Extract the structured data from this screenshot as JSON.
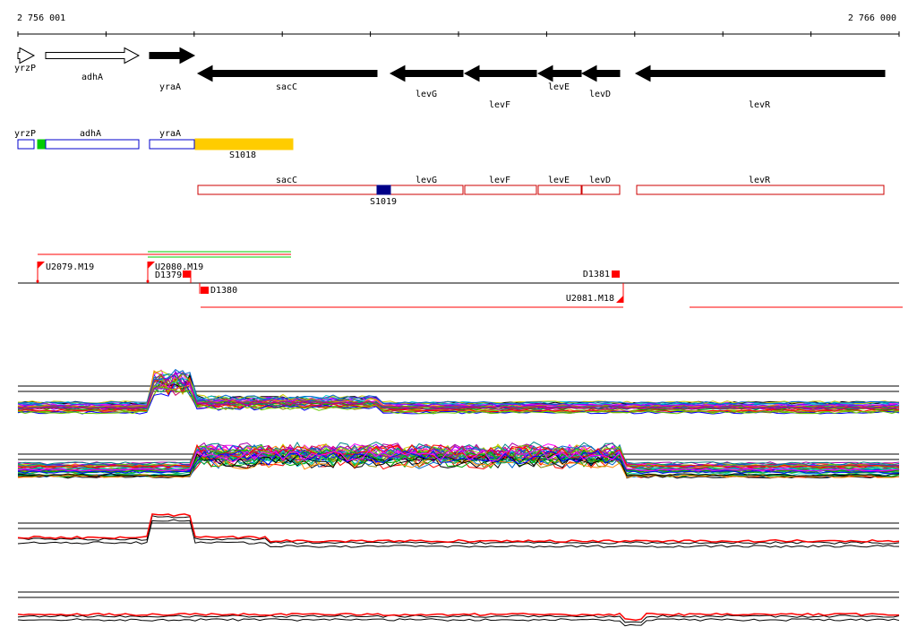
{
  "coordinates": {
    "start": "2 756 001",
    "end": "2 766 000"
  },
  "colors": {
    "gene_fill": "#000000",
    "gene_outline": "#000000",
    "blue_box": "#0000cc",
    "red_box": "#cc0000",
    "orange_box": "#ffcc00",
    "green_box": "#00cc00",
    "navy_box": "#000088",
    "marker_red": "#ff0000",
    "track_line": "#000000"
  },
  "genes_forward": [
    {
      "label": "yrzP",
      "start": 20,
      "end": 38,
      "filled": false
    },
    {
      "label": "adhA",
      "start": 51,
      "end": 155,
      "filled": false
    },
    {
      "label": "yraA",
      "start": 167,
      "end": 217,
      "filled": true
    }
  ],
  "genes_reverse": [
    {
      "label": "sacC",
      "start": 221,
      "end": 421
    },
    {
      "label": "levG",
      "start": 436,
      "end": 517
    },
    {
      "label": "levF",
      "start": 519,
      "end": 599
    },
    {
      "label": "levE",
      "start": 601,
      "end": 649
    },
    {
      "label": "levD",
      "start": 650,
      "end": 692
    },
    {
      "label": "levR",
      "start": 710,
      "end": 988
    }
  ],
  "annot_forward": [
    {
      "label": "yrzP",
      "start": 20,
      "end": 38,
      "type": "blue"
    },
    {
      "label": "",
      "start": 42,
      "end": 50,
      "type": "green"
    },
    {
      "label": "adhA",
      "start": 51,
      "end": 155,
      "type": "blue"
    },
    {
      "label": "yraA",
      "start": 167,
      "end": 217,
      "type": "blue"
    },
    {
      "label": "S1018",
      "start": 218,
      "end": 327,
      "type": "orange"
    }
  ],
  "annot_reverse": [
    {
      "label": "sacC",
      "start": 221,
      "end": 517,
      "type": "red"
    },
    {
      "label": "levG",
      "start": 436,
      "end": 517,
      "type": "none"
    },
    {
      "label": "levF",
      "start": 519,
      "end": 599,
      "type": "red"
    },
    {
      "label": "levE",
      "start": 601,
      "end": 649,
      "type": "red"
    },
    {
      "label": "levD",
      "start": 650,
      "end": 692,
      "type": "red"
    },
    {
      "label": "levR",
      "start": 711,
      "end": 987,
      "type": "red"
    },
    {
      "label": "S1019",
      "start": 421,
      "end": 436,
      "type": "navy"
    }
  ],
  "features_top": [
    {
      "label": "U2079.M19"
    },
    {
      "label": "U2080.M19"
    },
    {
      "label": "D1379"
    },
    {
      "label": "D1381"
    }
  ],
  "features_bottom": [
    {
      "label": "D1380"
    },
    {
      "label": "U2081.M18"
    }
  ]
}
